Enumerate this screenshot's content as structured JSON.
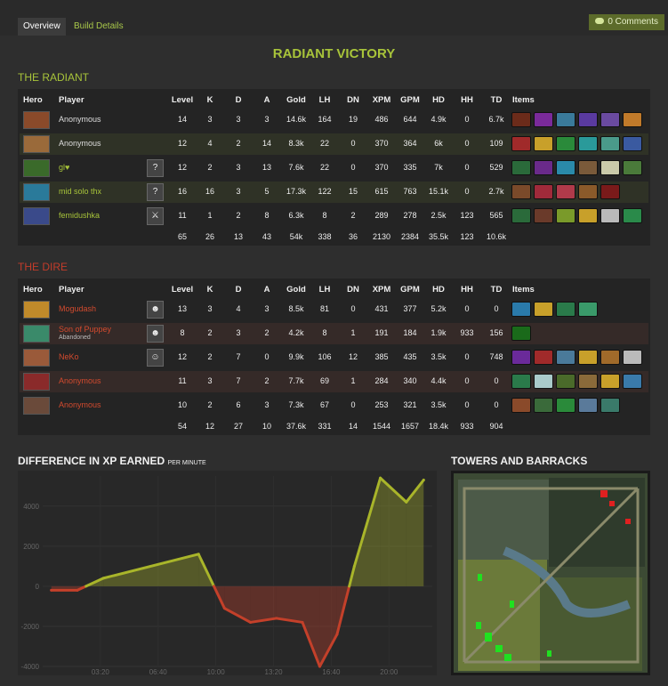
{
  "tabs": {
    "overview": "Overview",
    "build": "Build Details"
  },
  "comments": "0 Comments",
  "result": "RADIANT VICTORY",
  "headers": [
    "Hero",
    "Player",
    "Level",
    "K",
    "D",
    "A",
    "Gold",
    "LH",
    "DN",
    "XPM",
    "GPM",
    "HD",
    "HH",
    "TD",
    "Items"
  ],
  "radiant": {
    "title": "THE RADIANT",
    "players": [
      {
        "player": "Anonymous",
        "level": "14",
        "k": "3",
        "d": "3",
        "a": "3",
        "gold": "14.6k",
        "lh": "164",
        "dn": "19",
        "xpm": "486",
        "gpm": "644",
        "hd": "4.9k",
        "hh": "0",
        "td": "6.7k",
        "avatar": "",
        "hero_color": "#8a4a2a",
        "items": [
          "#6b2b1a",
          "#7a2a9a",
          "#3a7a9a",
          "#5a3aa0",
          "#6a4aa0",
          "#c07a2a"
        ]
      },
      {
        "player": "Anonymous",
        "level": "12",
        "k": "4",
        "d": "2",
        "a": "14",
        "gold": "8.3k",
        "lh": "22",
        "dn": "0",
        "xpm": "370",
        "gpm": "364",
        "hd": "6k",
        "hh": "0",
        "td": "109",
        "avatar": "",
        "hero_color": "#9a6a3a",
        "items": [
          "#a02a2a",
          "#c8a02a",
          "#2a8a3a",
          "#2a9a9a",
          "#4a9a8a",
          "#3a5aa0"
        ]
      },
      {
        "player": "gl♥",
        "level": "12",
        "k": "2",
        "d": "3",
        "a": "13",
        "gold": "7.6k",
        "lh": "22",
        "dn": "0",
        "xpm": "370",
        "gpm": "335",
        "hd": "7k",
        "hh": "0",
        "td": "529",
        "avatar": "?",
        "hero_color": "#3a6a2a",
        "items": [
          "#2a6a3a",
          "#6a2a8a",
          "#2a8aaa",
          "#7a5a3a",
          "#cacaaa",
          "#4a7a3a"
        ]
      },
      {
        "player": "mid solo thx",
        "level": "16",
        "k": "16",
        "d": "3",
        "a": "5",
        "gold": "17.3k",
        "lh": "122",
        "dn": "15",
        "xpm": "615",
        "gpm": "763",
        "hd": "15.1k",
        "hh": "0",
        "td": "2.7k",
        "avatar": "?",
        "hero_color": "#2a7a9a",
        "items": [
          "#7a4a2a",
          "#a02a3a",
          "#b03a4a",
          "#8a5a2a",
          "#7a1a1a"
        ]
      },
      {
        "player": "femidushka",
        "level": "11",
        "k": "1",
        "d": "2",
        "a": "8",
        "gold": "6.3k",
        "lh": "8",
        "dn": "2",
        "xpm": "289",
        "gpm": "278",
        "hd": "2.5k",
        "hh": "123",
        "td": "565",
        "avatar": "⚔",
        "hero_color": "#3a4a8a",
        "items": [
          "#2a6a3a",
          "#6a3a2a",
          "#7a9a2a",
          "#c8a02a",
          "#bababa",
          "#2a8a4a"
        ]
      }
    ],
    "totals": {
      "level": "65",
      "k": "26",
      "d": "13",
      "a": "43",
      "gold": "54k",
      "lh": "338",
      "dn": "36",
      "xpm": "2130",
      "gpm": "2384",
      "hd": "35.5k",
      "hh": "123",
      "td": "10.6k"
    }
  },
  "dire": {
    "title": "THE DIRE",
    "players": [
      {
        "player": "Mogudash",
        "abandoned": "",
        "level": "13",
        "k": "3",
        "d": "4",
        "a": "3",
        "gold": "8.5k",
        "lh": "81",
        "dn": "0",
        "xpm": "431",
        "gpm": "377",
        "hd": "5.2k",
        "hh": "0",
        "td": "0",
        "avatar": "☻",
        "hero_color": "#c08a2a",
        "items": [
          "#2a7aaa",
          "#c8a02a",
          "#2a7a4a",
          "#3a9a6a"
        ]
      },
      {
        "player": "Son of Puppey",
        "abandoned": "Abandoned",
        "level": "8",
        "k": "2",
        "d": "3",
        "a": "2",
        "gold": "4.2k",
        "lh": "8",
        "dn": "1",
        "xpm": "191",
        "gpm": "184",
        "hd": "1.9k",
        "hh": "933",
        "td": "156",
        "avatar": "☻",
        "hero_color": "#3a8a6a",
        "items": [
          "#1a6a1a"
        ]
      },
      {
        "player": "NeKo",
        "abandoned": "",
        "level": "12",
        "k": "2",
        "d": "7",
        "a": "0",
        "gold": "9.9k",
        "lh": "106",
        "dn": "12",
        "xpm": "385",
        "gpm": "435",
        "hd": "3.5k",
        "hh": "0",
        "td": "748",
        "avatar": "☺",
        "hero_color": "#9a5a3a",
        "items": [
          "#6a2a9a",
          "#a02a2a",
          "#4a7a9a",
          "#c8a02a",
          "#a06a2a",
          "#bababa"
        ]
      },
      {
        "player": "Anonymous",
        "abandoned": "",
        "level": "11",
        "k": "3",
        "d": "7",
        "a": "2",
        "gold": "7.7k",
        "lh": "69",
        "dn": "1",
        "xpm": "284",
        "gpm": "340",
        "hd": "4.4k",
        "hh": "0",
        "td": "0",
        "avatar": "",
        "hero_color": "#8a2a2a",
        "items": [
          "#2a7a4a",
          "#aacaca",
          "#4a6a2a",
          "#8a6a3a",
          "#c8a02a",
          "#3a7aaa"
        ]
      },
      {
        "player": "Anonymous",
        "abandoned": "",
        "level": "10",
        "k": "2",
        "d": "6",
        "a": "3",
        "gold": "7.3k",
        "lh": "67",
        "dn": "0",
        "xpm": "253",
        "gpm": "321",
        "hd": "3.5k",
        "hh": "0",
        "td": "0",
        "avatar": "",
        "hero_color": "#6a4a3a",
        "items": [
          "#8a4a2a",
          "#3a6a3a",
          "#2a8a3a",
          "#5a7a9a",
          "#3a7a6a"
        ]
      }
    ],
    "totals": {
      "level": "54",
      "k": "12",
      "d": "27",
      "a": "10",
      "gold": "37.6k",
      "lh": "331",
      "dn": "14",
      "xpm": "1544",
      "gpm": "1657",
      "hd": "18.4k",
      "hh": "933",
      "td": "904"
    }
  },
  "xp_chart": {
    "title": "DIFFERENCE IN XP EARNED",
    "subtitle": "PER MINUTE"
  },
  "towers_title": "TOWERS AND BARRACKS",
  "chart_data": {
    "type": "area",
    "title": "DIFFERENCE IN XP EARNED PER MINUTE",
    "xlabel": "",
    "ylabel": "",
    "x_ticks": [
      "03:20",
      "06:40",
      "10:00",
      "13:20",
      "16:40",
      "20:00"
    ],
    "y_ticks": [
      4000,
      2000,
      0,
      -2000,
      -4000
    ],
    "ylim": [
      -4000,
      5500
    ],
    "x_minutes": [
      0.5,
      2,
      3.5,
      9,
      10.5,
      12,
      13.5,
      15,
      16,
      17,
      18,
      19.5,
      21,
      22
    ],
    "values": [
      -200,
      -200,
      400,
      1600,
      -1100,
      -1800,
      -1600,
      -1800,
      -4000,
      -2400,
      1000,
      5400,
      4200,
      5300
    ],
    "positive_color": "#a9b52a",
    "negative_color": "#c4402a",
    "grid": true
  }
}
